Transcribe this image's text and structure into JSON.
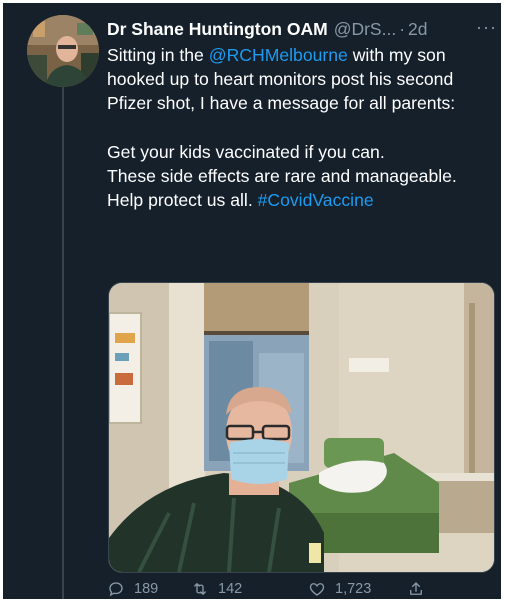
{
  "tweet": {
    "author_name": "Dr Shane Huntington OAM",
    "author_handle": "@DrS...",
    "separator": "·",
    "time": "2d",
    "more_label": "···",
    "text_parts": {
      "p1_before": "Sitting in the ",
      "p1_mention": "@RCHMelbourne",
      "p1_after": " with my son hooked up to heart monitors post his second Pfizer shot, I have a message for all parents:",
      "line1": "Get your kids vaccinated if you can.",
      "line2": "These side effects are rare and manageable.",
      "line3_before": "Help protect us all. ",
      "line3_hashtag": "#CovidVaccine"
    },
    "media_icon": "photo-of-man-in-hospital-room",
    "counts": {
      "replies": "189",
      "retweets": "142",
      "likes": "1,723"
    },
    "icons": {
      "reply": "reply-icon",
      "retweet": "retweet-icon",
      "like": "like-icon",
      "share": "share-icon"
    },
    "colors": {
      "background": "#15202b",
      "text": "#ffffff",
      "secondary": "#8899a6",
      "link": "#1d9bf0"
    }
  }
}
